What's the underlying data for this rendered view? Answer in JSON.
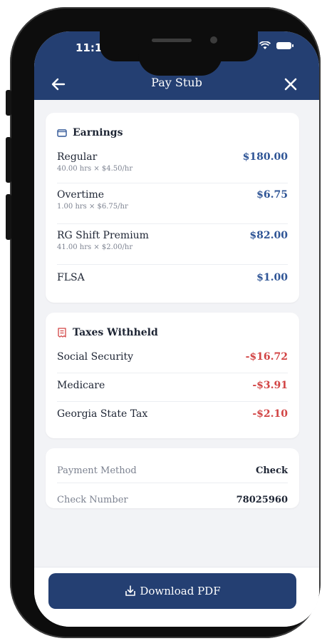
{
  "status_bar": {
    "time": "11:1"
  },
  "header": {
    "title": "Pay Stub",
    "back_icon": "arrow-left-icon",
    "close_icon": "close-icon"
  },
  "earnings": {
    "title": "Earnings",
    "icon": "wallet-icon",
    "items": [
      {
        "name": "Regular",
        "detail": "40.00 hrs × $4.50/hr",
        "amount": "$180.00"
      },
      {
        "name": "Overtime",
        "detail": "1.00 hrs × $6.75/hr",
        "amount": "$6.75"
      },
      {
        "name": "RG Shift Premium",
        "detail": "41.00 hrs × $2.00/hr",
        "amount": "$82.00"
      },
      {
        "name": "FLSA",
        "detail": "",
        "amount": "$1.00"
      }
    ]
  },
  "taxes": {
    "title": "Taxes Withheld",
    "icon": "receipt-icon",
    "items": [
      {
        "name": "Social Security",
        "amount": "-$16.72"
      },
      {
        "name": "Medicare",
        "amount": "-$3.91"
      },
      {
        "name": "Georgia State Tax",
        "amount": "-$2.10"
      }
    ]
  },
  "payment": {
    "method_label": "Payment Method",
    "method_value": "Check",
    "check_label": "Check Number",
    "check_value": "78025960"
  },
  "footer": {
    "download_label": "Download PDF",
    "download_icon": "download-icon"
  },
  "colors": {
    "primary": "#243f72",
    "positive": "#2f5596",
    "negative": "#d24545",
    "background": "#f2f3f6"
  }
}
